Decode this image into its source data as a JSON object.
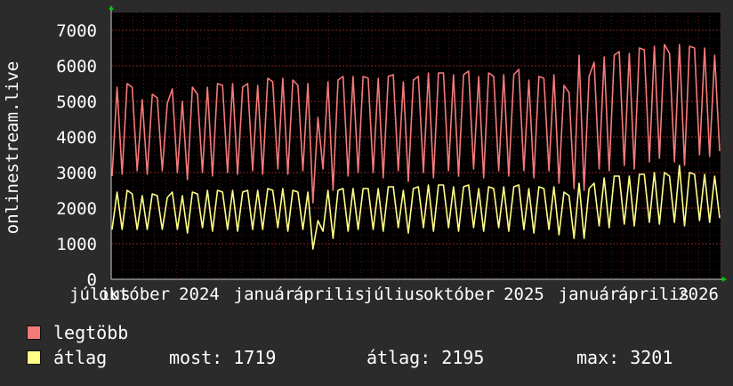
{
  "chart_data": {
    "type": "line",
    "ylabel": "onlinestream.live",
    "ylim": [
      0,
      7500
    ],
    "y_ticks": [
      0,
      1000,
      2000,
      3000,
      4000,
      5000,
      6000,
      7000
    ],
    "x_tick_labels": [
      "július",
      "október",
      "2024",
      "január",
      "április",
      "július",
      "október",
      "2025",
      "január",
      "április",
      "2026"
    ],
    "grid": true,
    "legend_placement": "bottom-left",
    "background_color": "#000000",
    "frame_color": "#2b2b2b",
    "grid_color": "#8a2525",
    "axis_color": "#00cc00",
    "series": [
      {
        "name": "legtöbb",
        "color": "#f47a7a",
        "values": [
          2900,
          5400,
          2950,
          5500,
          5400,
          3050,
          5050,
          2950,
          5200,
          5100,
          3050,
          4950,
          5350,
          3000,
          5000,
          2800,
          5400,
          5200,
          3000,
          5400,
          2900,
          5500,
          5450,
          3000,
          5500,
          2950,
          5400,
          5500,
          3050,
          5450,
          2950,
          5650,
          5550,
          3100,
          5650,
          2950,
          5600,
          5450,
          3050,
          5500,
          2150,
          4550,
          3100,
          5550,
          2500,
          5600,
          5700,
          2900,
          5700,
          3000,
          5700,
          5650,
          3000,
          5650,
          2850,
          5700,
          5750,
          3050,
          5550,
          2750,
          5600,
          5700,
          3000,
          5800,
          2850,
          5800,
          5800,
          3050,
          5750,
          2900,
          5750,
          5850,
          3100,
          5700,
          2850,
          5800,
          5700,
          3050,
          5750,
          2900,
          5750,
          5900,
          3050,
          5600,
          2850,
          5700,
          5650,
          3050,
          5750,
          2700,
          5450,
          5250,
          2550,
          6300,
          2500,
          5700,
          6100,
          3100,
          6250,
          3050,
          6300,
          6400,
          3200,
          6350,
          3100,
          6500,
          6450,
          3300,
          6550,
          3400,
          6600,
          6350,
          3300,
          6600,
          3200,
          6550,
          6500,
          3500,
          6500,
          3450,
          6300,
          3600
        ],
        "last": 3600
      },
      {
        "name": "átlag",
        "color": "#ffff88",
        "values": [
          1400,
          2450,
          1400,
          2500,
          2400,
          1400,
          2350,
          1400,
          2400,
          2350,
          1400,
          2300,
          2450,
          1400,
          2350,
          1300,
          2450,
          2400,
          1450,
          2500,
          1350,
          2500,
          2450,
          1400,
          2500,
          1350,
          2450,
          2500,
          1400,
          2500,
          1400,
          2550,
          2500,
          1450,
          2550,
          1350,
          2500,
          2450,
          1400,
          2450,
          850,
          1650,
          1350,
          2500,
          1150,
          2500,
          2550,
          1350,
          2550,
          1400,
          2550,
          2550,
          1400,
          2550,
          1350,
          2600,
          2600,
          1450,
          2500,
          1300,
          2550,
          2600,
          1450,
          2650,
          1350,
          2650,
          2650,
          1450,
          2600,
          1350,
          2600,
          2650,
          1450,
          2550,
          1350,
          2600,
          2550,
          1450,
          2600,
          1350,
          2600,
          2650,
          1400,
          2550,
          1300,
          2600,
          2550,
          1400,
          2600,
          1250,
          2450,
          2350,
          1150,
          2700,
          1150,
          2550,
          2700,
          1500,
          2850,
          1450,
          2900,
          2900,
          1550,
          2900,
          1500,
          2950,
          2950,
          1600,
          3000,
          1550,
          3000,
          2900,
          1600,
          3201,
          1500,
          3000,
          2950,
          1650,
          2950,
          1600,
          2900,
          1719
        ],
        "last": 1719
      }
    ]
  },
  "legend": {
    "max_label": "legtöbb",
    "avg_label": "átlag",
    "now_text": "most: 1719",
    "avg_text": "átlag: 2195",
    "peak_text": "max: 3201"
  }
}
